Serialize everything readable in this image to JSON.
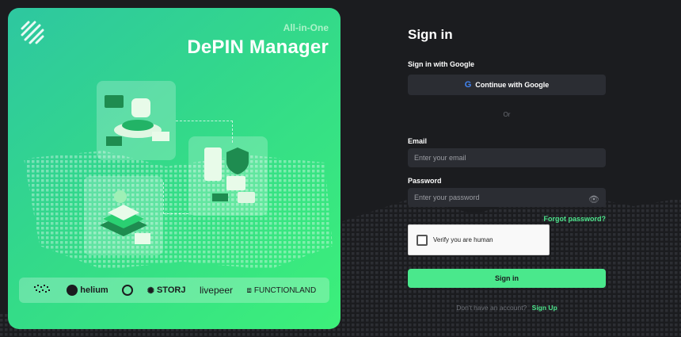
{
  "hero": {
    "tagline": "All-in-One",
    "title": "DePIN Manager",
    "partners": [
      "helium",
      "STORJ",
      "livepeer",
      "FUNCTIONLAND"
    ]
  },
  "signin": {
    "title": "Sign in",
    "google_label": "Sign in with Google",
    "google_button": "Continue with Google",
    "or": "Or",
    "email_label": "Email",
    "email_placeholder": "Enter your email",
    "password_label": "Password",
    "password_placeholder": "Enter your password",
    "forgot": "Forgot password?",
    "captcha": "Verify you are human",
    "submit": "Sign in",
    "no_account": "Don't have an account?",
    "signup": "Sign Up"
  },
  "colors": {
    "accent": "#4ae88c",
    "background": "#1b1c1f",
    "input": "#2b2d33"
  }
}
